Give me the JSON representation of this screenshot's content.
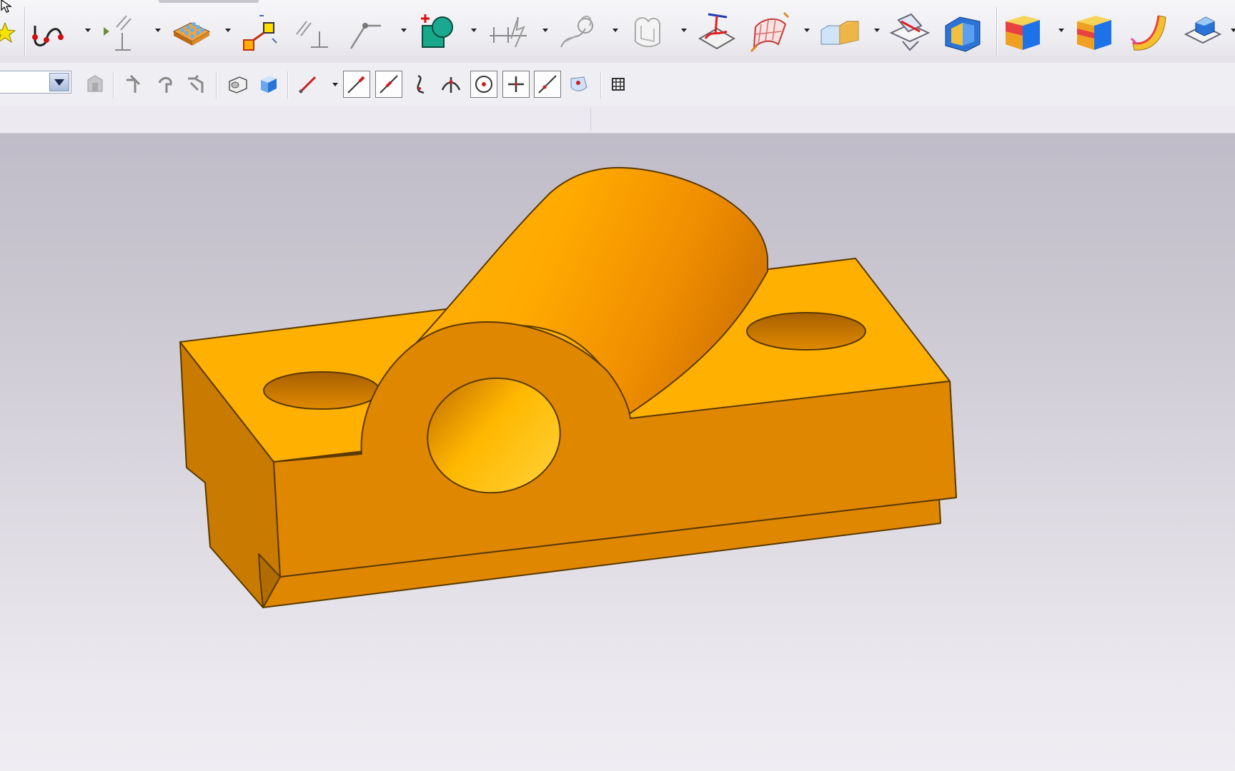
{
  "toolbar_top": {
    "tools": [
      {
        "icon": "sketch-star-icon"
      },
      {
        "icon": "studio-spline-icon"
      },
      {
        "icon": "parallel-perpendicular-icon"
      },
      {
        "icon": "pattern-feature-icon"
      },
      {
        "icon": "scale-body-icon"
      },
      {
        "icon": "offset-lines-icon"
      },
      {
        "icon": "line-point-icon"
      },
      {
        "icon": "add-shape-icon"
      },
      {
        "icon": "dimension-icon"
      },
      {
        "icon": "curve-constraint-icon"
      },
      {
        "icon": "bounded-plane-icon"
      },
      {
        "icon": "section-surface-icon"
      },
      {
        "icon": "mesh-surface-icon"
      },
      {
        "icon": "solid-blocks-icon"
      },
      {
        "icon": "plane-cut-icon"
      },
      {
        "icon": "shell-icon"
      },
      {
        "icon": "blue-block-icon"
      },
      {
        "icon": "orange-block-icon"
      },
      {
        "icon": "curved-sheet-icon"
      },
      {
        "icon": "view-cube-icon"
      }
    ]
  },
  "toolbar_bottom": {
    "selection_filter": {
      "value": ""
    },
    "tools": [
      {
        "icon": "snap-settings-icon"
      },
      {
        "icon": "curve-rule-icon"
      },
      {
        "icon": "feature-curve-icon"
      },
      {
        "icon": "tangent-curves-icon"
      },
      {
        "icon": "body-select-icon"
      },
      {
        "icon": "face-select-icon"
      },
      {
        "icon": "line-select-icon"
      },
      {
        "icon": "end-point-icon"
      },
      {
        "icon": "mid-point-icon"
      },
      {
        "icon": "control-point-icon"
      },
      {
        "icon": "intersection-point-icon"
      },
      {
        "icon": "arc-center-icon"
      },
      {
        "icon": "quadrant-point-icon"
      },
      {
        "icon": "point-on-curve-icon"
      },
      {
        "icon": "point-on-face-icon"
      },
      {
        "icon": "grid-icon"
      }
    ]
  },
  "model": {
    "name": "bearing-bracket-3d-model",
    "colors": {
      "top": "#ffb000",
      "front": "#e08700",
      "side": "#c97a00",
      "hole": "#ffcf1a",
      "edge": "#5a3a00"
    }
  },
  "cursor": {
    "icon": "mouse-pointer-icon"
  }
}
